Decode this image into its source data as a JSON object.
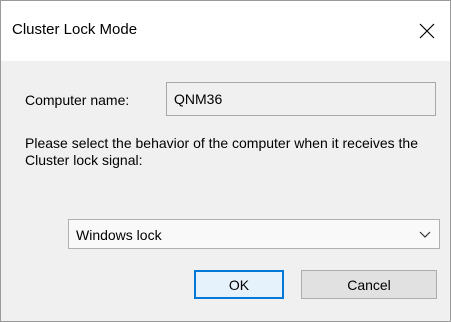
{
  "window": {
    "title": "Cluster Lock Mode"
  },
  "computer_name": {
    "label": "Computer name:",
    "value": "QNM36"
  },
  "prompt": "Please select the behavior of the computer when it receives the Cluster lock signal:",
  "behavior_select": {
    "selected": "Windows lock"
  },
  "buttons": {
    "ok": "OK",
    "cancel": "Cancel"
  },
  "icons": {
    "close": "close-icon",
    "dropdown": "chevron-down-icon"
  },
  "colors": {
    "focus_border": "#0078d7"
  }
}
